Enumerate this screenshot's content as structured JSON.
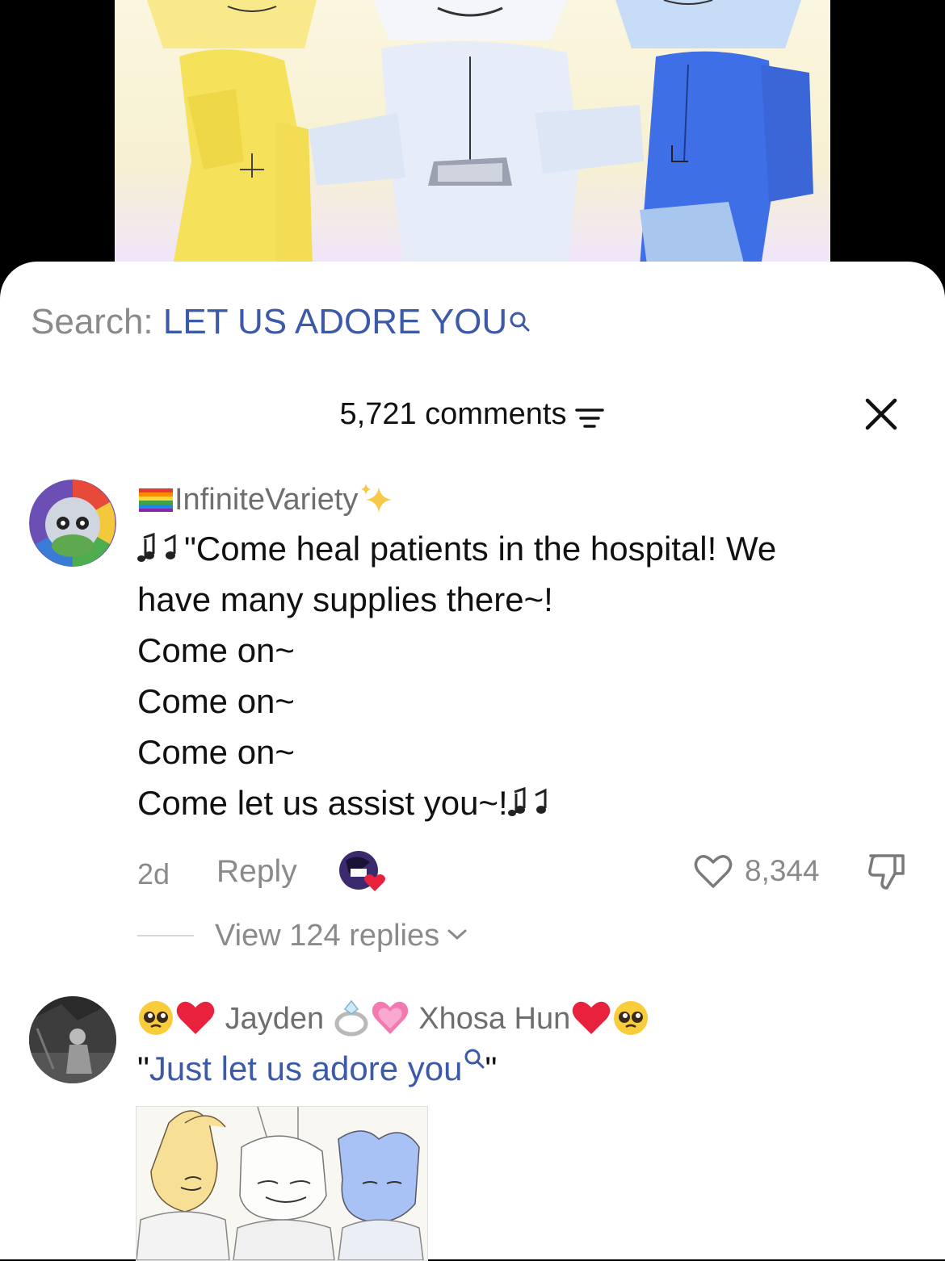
{
  "search": {
    "prefix": "Search: ",
    "term": "LET US ADORE YOU"
  },
  "header": {
    "comments_count": "5,721 comments"
  },
  "comment1": {
    "username": "InfiniteVariety",
    "lines": [
      "\"Come heal patients in the hospital! We",
      "have many supplies there~!",
      "Come on~",
      "Come on~",
      "Come on~",
      "Come let us assist you~!"
    ],
    "age": "2d",
    "reply_label": "Reply",
    "likes": "8,344",
    "view_replies": "View 124 replies"
  },
  "comment2": {
    "username_part1": "Jayden",
    "username_part2": "Xhosa Hun",
    "quote_open": "\"",
    "link_text": "Just let us adore you",
    "quote_close": "\""
  },
  "colors": {
    "link": "#3d5aa8",
    "secondary_text": "#8a8a8a",
    "primary_text": "#111111",
    "heart_red": "#e8213d"
  }
}
